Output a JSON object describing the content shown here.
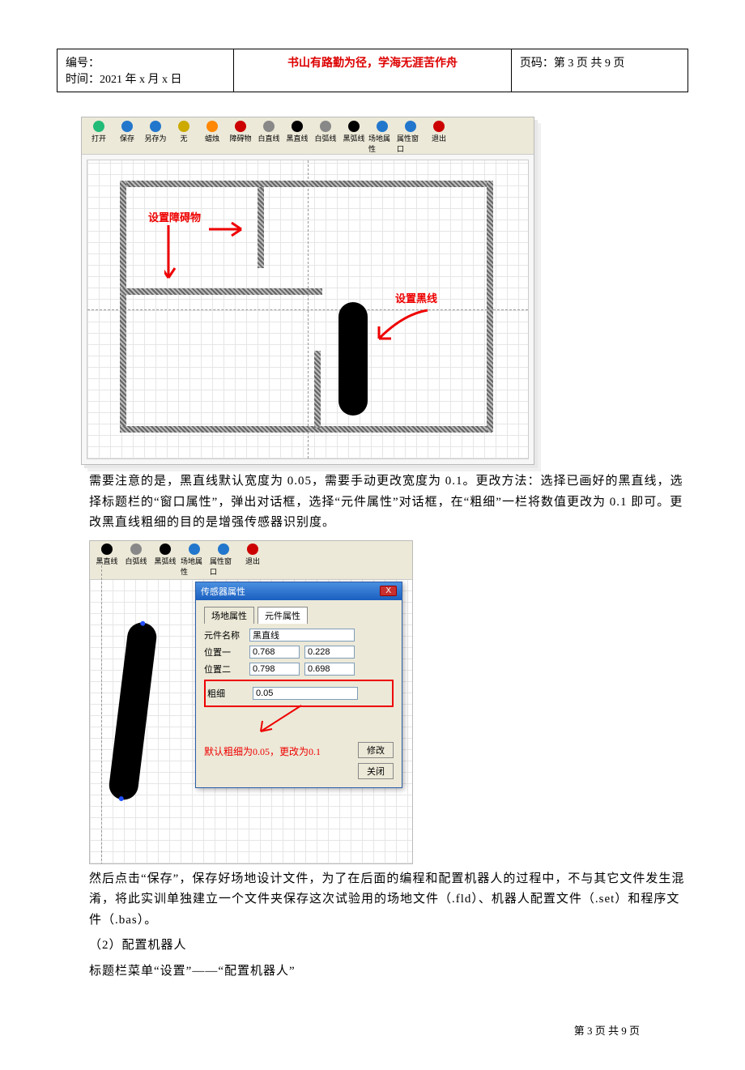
{
  "header": {
    "id_label": "编号：",
    "time_label": "时间：2021 年 x 月 x 日",
    "motto": "书山有路勤为径，学海无涯苦作舟",
    "page_label": "页码：第 3 页 共 9 页"
  },
  "shot1": {
    "toolbar": [
      {
        "label": "打开",
        "color": "#2b7"
      },
      {
        "label": "保存",
        "color": "#27c"
      },
      {
        "label": "另存为",
        "color": "#27c"
      },
      {
        "label": "无",
        "color": "#ca0"
      },
      {
        "label": "蜡烛",
        "color": "#f80"
      },
      {
        "label": "障碍物",
        "color": "#c00"
      },
      {
        "label": "白直线",
        "color": "#888"
      },
      {
        "label": "黑直线",
        "color": "#000"
      },
      {
        "label": "白弧线",
        "color": "#888"
      },
      {
        "label": "黑弧线",
        "color": "#000"
      },
      {
        "label": "场地属性",
        "color": "#27c"
      },
      {
        "label": "属性窗口",
        "color": "#27c"
      },
      {
        "label": "退出",
        "color": "#c00"
      }
    ],
    "annot_obstacle": "设置障碍物",
    "annot_blackline": "设置黑线"
  },
  "para1": "需要注意的是，黑直线默认宽度为 0.05，需要手动更改宽度为 0.1。更改方法：选择已画好的黑直线，选择标题栏的“窗口属性”，弹出对话框，选择“元件属性”对话框，在“粗细”一栏将数值更改为 0.1 即可。更改黑直线粗细的目的是增强传感器识别度。",
  "shot2": {
    "toolbar": [
      {
        "label": "黑直线",
        "color": "#000"
      },
      {
        "label": "白弧线",
        "color": "#888"
      },
      {
        "label": "黑弧线",
        "color": "#000"
      },
      {
        "label": "场地属性",
        "color": "#27c"
      },
      {
        "label": "属性窗口",
        "color": "#27c"
      },
      {
        "label": "退出",
        "color": "#c00"
      }
    ],
    "dialog": {
      "title": "传感器属性",
      "tab1": "场地属性",
      "tab2": "元件属性",
      "row_name_label": "元件名称",
      "row_name_value": "黑直线",
      "row_pos1_label": "位置一",
      "row_pos1_a": "0.768",
      "row_pos1_b": "0.228",
      "row_pos2_label": "位置二",
      "row_pos2_a": "0.798",
      "row_pos2_b": "0.698",
      "row_thick_label": "粗细",
      "row_thick_value": "0.05",
      "note": "默认粗细为0.05，更改为0.1",
      "btn_modify": "修改",
      "btn_close": "关闭"
    }
  },
  "para2": "然后点击“保存”，保存好场地设计文件，为了在后面的编程和配置机器人的过程中，不与其它文件发生混淆，将此实训单独建立一个文件夹保存这次试验用的场地文件（.fld）、机器人配置文件（.set）和程序文件（.bas）。",
  "para3": "（2）配置机器人",
  "para4": "标题栏菜单“设置”——“配置机器人”",
  "footer": "第 3 页 共 9 页"
}
